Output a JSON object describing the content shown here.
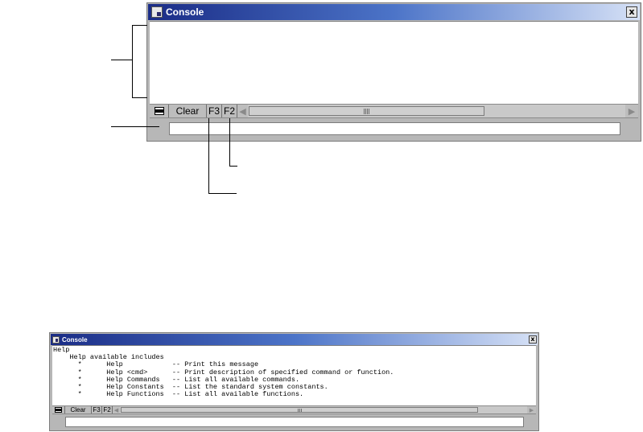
{
  "top_window": {
    "title": "Console",
    "close_label": "x",
    "toolbar": {
      "menu_icon": "console-menu-icon",
      "clear_label": "Clear",
      "f3_label": "F3",
      "f2_label": "F2",
      "scroll_left_icon": "arrow-left-icon",
      "scroll_right_icon": "arrow-right-icon"
    },
    "command_value": ""
  },
  "bottom_window": {
    "title": "Console",
    "close_label": "x",
    "output_lines": [
      "Help",
      "    Help available includes",
      "      *      Help            -- Print this message",
      "      *      Help <cmd>      -- Print description of specified command or function.",
      "      *      Help Commands   -- List all available commands.",
      "      *      Help Constants  -- List the standard system constants.",
      "      *      Help Functions  -- List all available functions."
    ],
    "toolbar": {
      "menu_icon": "console-menu-icon",
      "clear_label": "Clear",
      "f3_label": "F3",
      "f2_label": "F2",
      "scroll_left_icon": "arrow-left-icon",
      "scroll_right_icon": "arrow-right-icon"
    },
    "command_value": ""
  },
  "colors": {
    "title_gradient_start": "#1a2c86",
    "title_gradient_end": "#d6e1f6",
    "window_gray": "#b7b7b7"
  }
}
